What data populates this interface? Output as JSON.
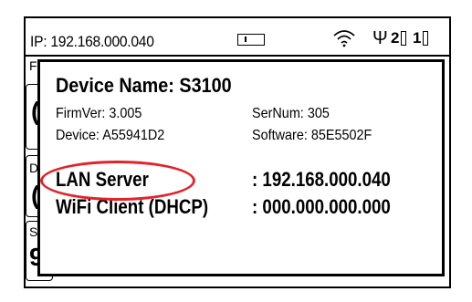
{
  "status_bar": {
    "ip_text": "IP: 192.168.000.040",
    "port_1": "2",
    "port_2": "1"
  },
  "background_screen": {
    "label_d": "D",
    "label_s": "S",
    "partial_text_top": "F",
    "partial_big_1": "(",
    "partial_big_2": "(",
    "partial_big_3": "9"
  },
  "device_info": {
    "title": "Device Name:  S3100",
    "firmver": "FirmVer:  3.005",
    "sernum": "SerNum:  305",
    "device": "Device: A55941D2",
    "software": "Software: 85E5502F",
    "lan_label": "LAN Server",
    "lan_value": ": 192.168.000.040",
    "wifi_label": "WiFi Client (DHCP)",
    "wifi_value": ": 000.000.000.000"
  },
  "colors": {
    "highlight": "#e0242a",
    "foreground": "#000000",
    "background": "#ffffff"
  },
  "icons": [
    "battery-icon",
    "wifi-icon",
    "usb-icon",
    "port-icon"
  ]
}
